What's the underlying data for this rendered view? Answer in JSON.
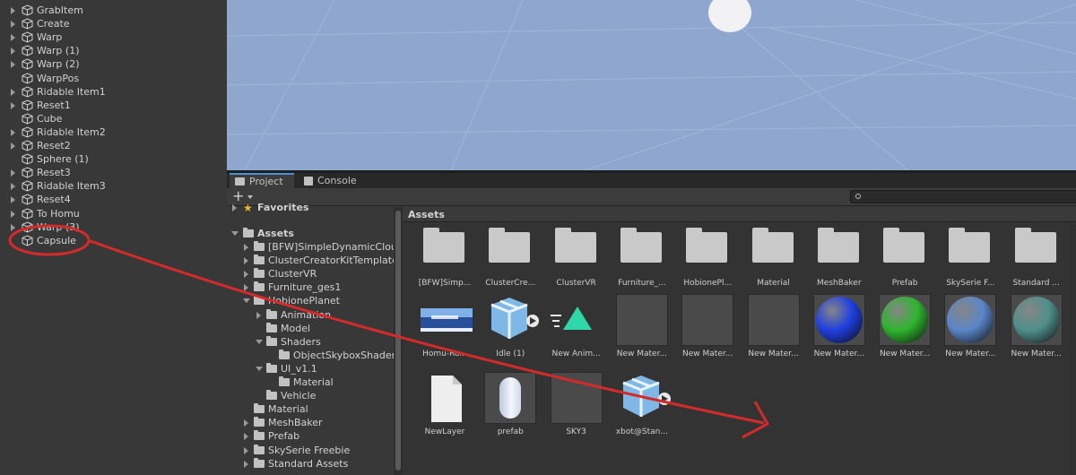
{
  "hierarchy": {
    "items": [
      {
        "label": "GrabItem",
        "expandable": true
      },
      {
        "label": "Create",
        "expandable": true
      },
      {
        "label": "Warp",
        "expandable": true
      },
      {
        "label": "Warp (1)",
        "expandable": true
      },
      {
        "label": "Warp (2)",
        "expandable": true
      },
      {
        "label": "WarpPos",
        "expandable": false
      },
      {
        "label": "Ridable Item1",
        "expandable": true
      },
      {
        "label": "Reset1",
        "expandable": true
      },
      {
        "label": "Cube",
        "expandable": false
      },
      {
        "label": "Ridable Item2",
        "expandable": true
      },
      {
        "label": "Reset2",
        "expandable": true
      },
      {
        "label": "Sphere (1)",
        "expandable": false
      },
      {
        "label": "Reset3",
        "expandable": true
      },
      {
        "label": "Ridable Item3",
        "expandable": true
      },
      {
        "label": "Reset4",
        "expandable": true
      },
      {
        "label": "To Homu",
        "expandable": true
      },
      {
        "label": "Warp (3)",
        "expandable": true
      },
      {
        "label": "Capsule",
        "expandable": false
      }
    ]
  },
  "tabs": [
    {
      "label": "Project",
      "active": true
    },
    {
      "label": "Console",
      "active": false
    }
  ],
  "toolbar": {
    "add_label": "+"
  },
  "tree": {
    "favorites_label": "Favorites",
    "assets_label": "Assets",
    "items": [
      {
        "label": "[BFW]SimpleDynamicClou",
        "depth": 1,
        "open": false
      },
      {
        "label": "ClusterCreatorKitTemplate",
        "depth": 1,
        "open": false
      },
      {
        "label": "ClusterVR",
        "depth": 1,
        "open": false
      },
      {
        "label": "Furniture_ges1",
        "depth": 1,
        "open": false
      },
      {
        "label": "HobionePlanet",
        "depth": 1,
        "open": true
      },
      {
        "label": "Animation",
        "depth": 2,
        "open": false
      },
      {
        "label": "Model",
        "depth": 2,
        "open": null
      },
      {
        "label": "Shaders",
        "depth": 2,
        "open": true
      },
      {
        "label": "ObjectSkyboxShader",
        "depth": 3,
        "open": null
      },
      {
        "label": "UI_v1.1",
        "depth": 2,
        "open": true
      },
      {
        "label": "Material",
        "depth": 3,
        "open": null
      },
      {
        "label": "Vehicle",
        "depth": 2,
        "open": null
      },
      {
        "label": "Material",
        "depth": 1,
        "open": null
      },
      {
        "label": "MeshBaker",
        "depth": 1,
        "open": false
      },
      {
        "label": "Prefab",
        "depth": 1,
        "open": false
      },
      {
        "label": "SkySerie Freebie",
        "depth": 1,
        "open": false
      },
      {
        "label": "Standard Assets",
        "depth": 1,
        "open": false
      }
    ]
  },
  "grid": {
    "breadcrumb": "Assets",
    "row1": [
      {
        "label": "[BFW]Simp...",
        "kind": "folder"
      },
      {
        "label": "ClusterCre...",
        "kind": "folder"
      },
      {
        "label": "ClusterVR",
        "kind": "folder"
      },
      {
        "label": "Furniture_...",
        "kind": "folder"
      },
      {
        "label": "HobionePl...",
        "kind": "folder"
      },
      {
        "label": "Material",
        "kind": "folder"
      },
      {
        "label": "MeshBaker",
        "kind": "folder"
      },
      {
        "label": "Prefab",
        "kind": "folder"
      },
      {
        "label": "SkySerie F...",
        "kind": "folder"
      },
      {
        "label": "Standard ...",
        "kind": "folder"
      }
    ],
    "row2": [
      {
        "label": "Homu-Ro...",
        "kind": "texture"
      },
      {
        "label": "Idle (1)",
        "kind": "model"
      },
      {
        "label": "New Anim...",
        "kind": "anim"
      },
      {
        "label": "New Mater...",
        "kind": "grey"
      },
      {
        "label": "New Mater...",
        "kind": "grey"
      },
      {
        "label": "New Mater...",
        "kind": "grey"
      },
      {
        "label": "New Mater...",
        "kind": "sphere",
        "color": "#1f3fe0"
      },
      {
        "label": "New Mater...",
        "kind": "sphere",
        "color": "#2eb52e"
      },
      {
        "label": "New Mater...",
        "kind": "sphere",
        "color": "#5a86c8"
      },
      {
        "label": "New Mater...",
        "kind": "sphere",
        "color": "#4f8f8a"
      }
    ],
    "row3": [
      {
        "label": "NewLayer",
        "kind": "doc"
      },
      {
        "label": "prefab",
        "kind": "capsule"
      },
      {
        "label": "SKY3",
        "kind": "grey"
      },
      {
        "label": "xbot@Stan...",
        "kind": "model"
      }
    ]
  },
  "colors": {
    "scene_sky": "#8fa7cf",
    "annotation": "#d42a2a",
    "tab_accent": "#4a8fd8"
  }
}
